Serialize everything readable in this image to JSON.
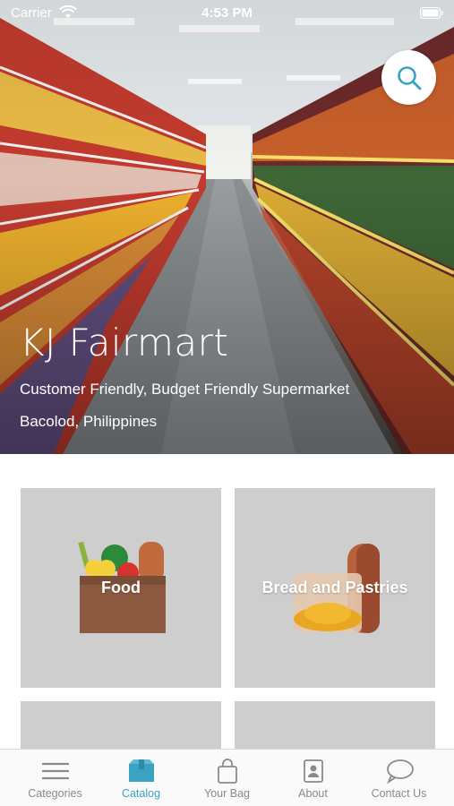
{
  "status_bar": {
    "carrier": "Carrier",
    "time": "4:53 PM"
  },
  "hero": {
    "title": "KJ Fairmart",
    "tagline": "Customer Friendly, Budget Friendly Supermarket",
    "location": "Bacolod, Philippines"
  },
  "search": {
    "icon": "search-icon"
  },
  "categories": [
    {
      "label": "Food",
      "icon": "grocery-bag-icon"
    },
    {
      "label": "Bread and Pastries",
      "icon": "bread-icon"
    },
    {
      "label": "",
      "icon": ""
    },
    {
      "label": "",
      "icon": ""
    }
  ],
  "tabs": [
    {
      "label": "Categories",
      "icon": "menu-icon",
      "active": false
    },
    {
      "label": "Catalog",
      "icon": "box-icon",
      "active": true
    },
    {
      "label": "Your Bag",
      "icon": "shopping-bag-icon",
      "active": false
    },
    {
      "label": "About",
      "icon": "contact-card-icon",
      "active": false
    },
    {
      "label": "Contact Us",
      "icon": "chat-bubble-icon",
      "active": false
    }
  ],
  "colors": {
    "accent": "#3aa3c2",
    "tile": "#cecece",
    "tab_inactive": "#8a8a8a"
  }
}
